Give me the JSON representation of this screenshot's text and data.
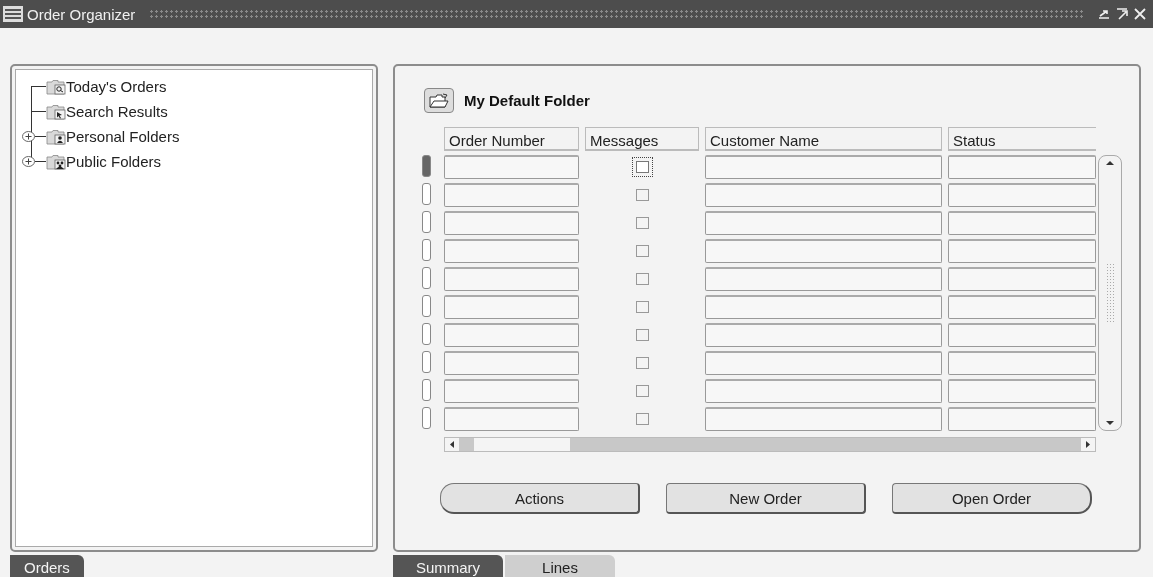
{
  "window": {
    "title": "Order Organizer"
  },
  "navigator": {
    "tree": [
      {
        "label": "Today's Orders",
        "kind": "leaf"
      },
      {
        "label": "Search Results",
        "kind": "leaf"
      },
      {
        "label": "Personal Folders",
        "kind": "branch",
        "expanded": false
      },
      {
        "label": "Public Folders",
        "kind": "branch",
        "expanded": false
      }
    ],
    "tabs": [
      {
        "label": "Orders",
        "selected": true
      }
    ]
  },
  "summary": {
    "folder_title": "My Default Folder",
    "columns": [
      "Order Number",
      "Messages",
      "Customer Name",
      "Status"
    ],
    "rows": [
      {
        "selected": true,
        "checked": false
      },
      {
        "selected": false,
        "checked": false
      },
      {
        "selected": false,
        "checked": false
      },
      {
        "selected": false,
        "checked": false
      },
      {
        "selected": false,
        "checked": false
      },
      {
        "selected": false,
        "checked": false
      },
      {
        "selected": false,
        "checked": false
      },
      {
        "selected": false,
        "checked": false
      },
      {
        "selected": false,
        "checked": false
      },
      {
        "selected": false,
        "checked": false
      }
    ],
    "buttons": [
      "Actions",
      "New Order",
      "Open Order"
    ]
  },
  "tabs": [
    {
      "label": "Summary",
      "selected": true
    },
    {
      "label": "Lines",
      "selected": false
    }
  ]
}
